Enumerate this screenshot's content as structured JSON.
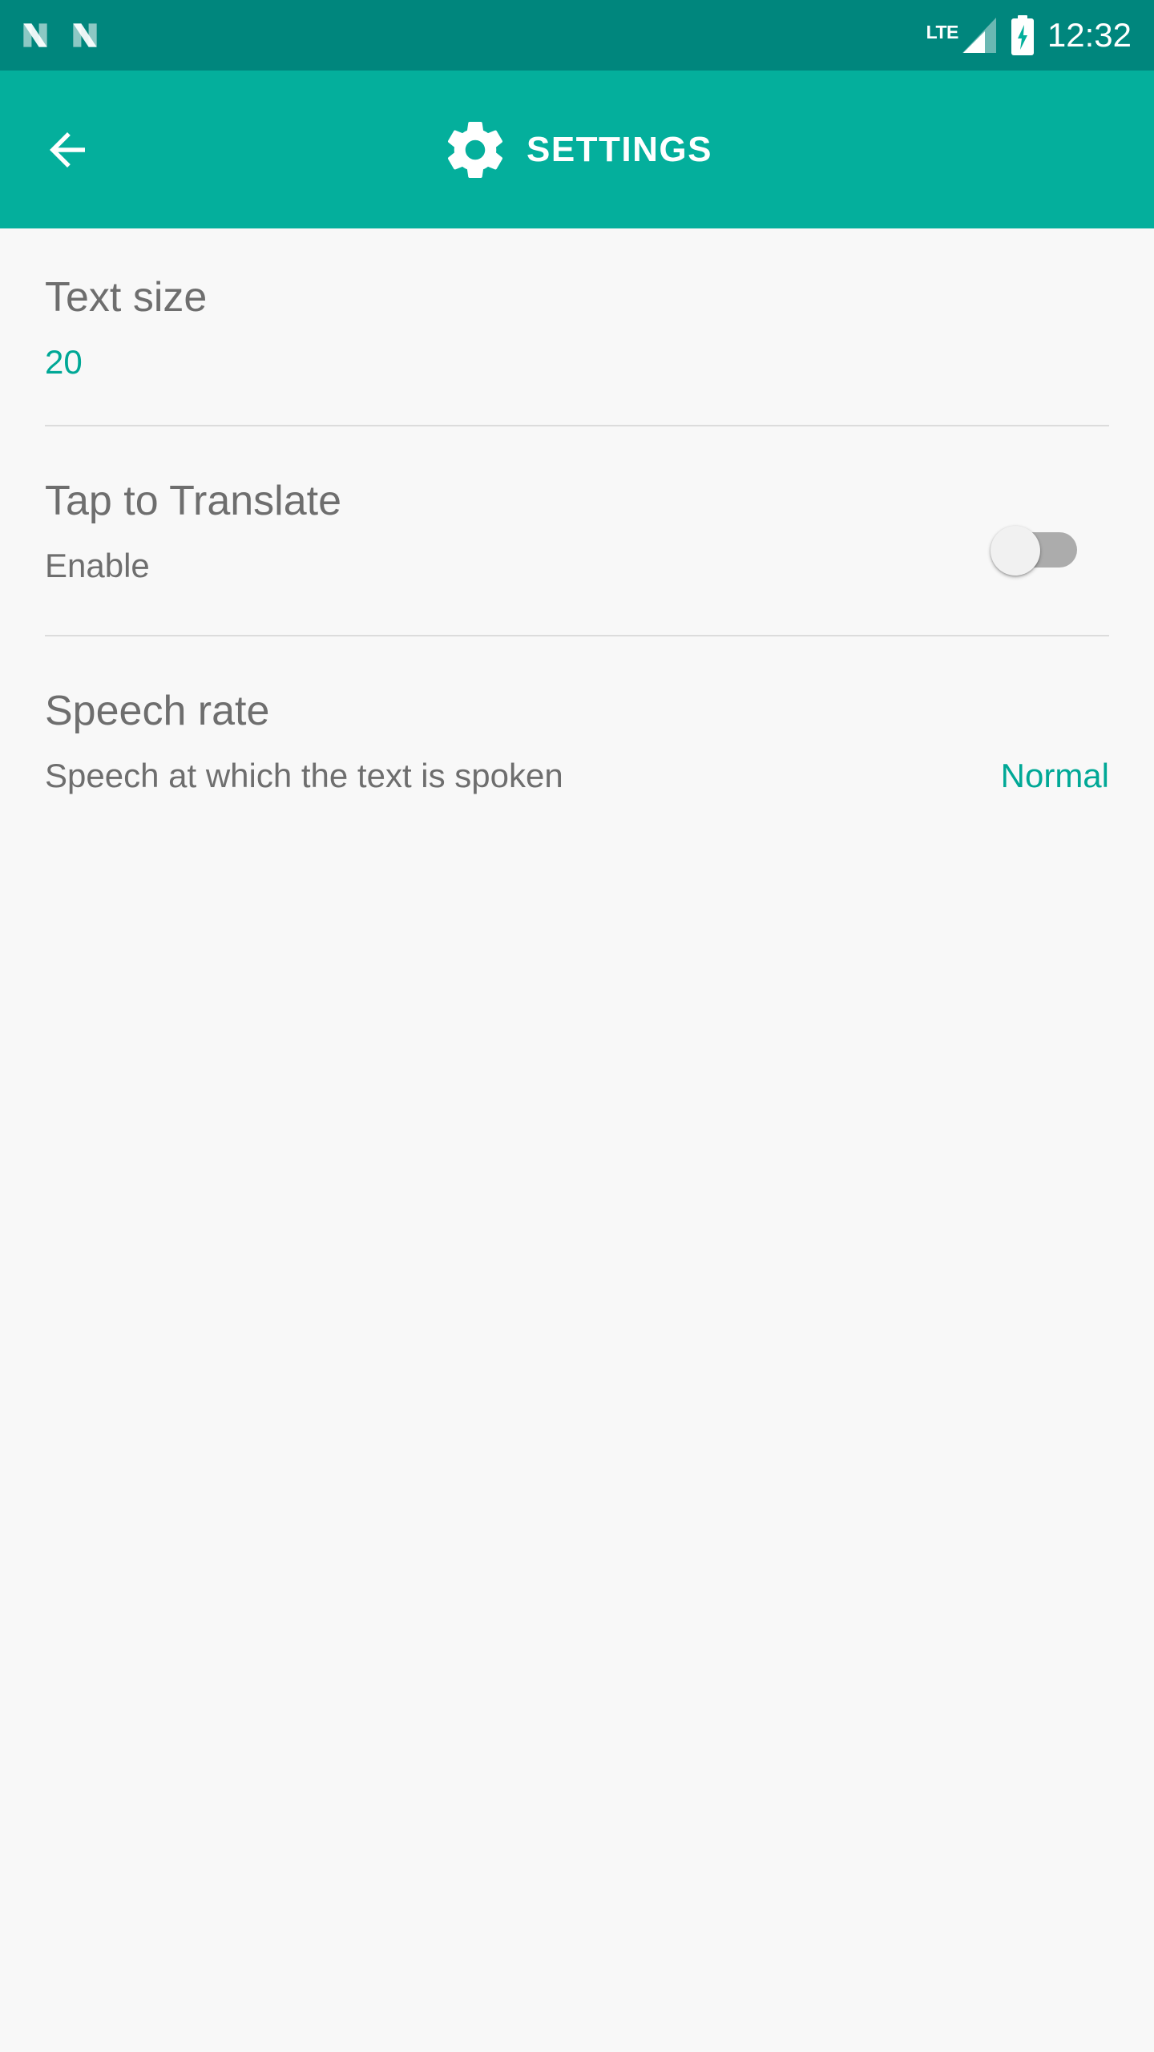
{
  "status_bar": {
    "notification_icons": [
      "nougat-n-icon",
      "nougat-n-icon"
    ],
    "network_label": "LTE",
    "signal_icon": "signal-triangle-icon",
    "battery_icon": "battery-charging-icon",
    "time": "12:32",
    "background_color": "#00867D"
  },
  "app_bar": {
    "back_icon": "back-arrow-icon",
    "gear_icon": "gear-icon",
    "title": "SETTINGS",
    "background_color": "#04AF9C",
    "text_color": "#FFFFFF"
  },
  "theme": {
    "accent_color": "#00A896",
    "content_background": "#F8F8F8",
    "primary_text_color": "#6E6E6E",
    "divider_color": "#DCDCDC"
  },
  "settings": {
    "text_size": {
      "title": "Text size",
      "value": "20"
    },
    "tap_to_translate": {
      "title": "Tap to Translate",
      "summary": "Enable",
      "toggle_state": "off"
    },
    "speech_rate": {
      "title": "Speech rate",
      "summary": "Speech at which the text is spoken",
      "value": "Normal"
    }
  }
}
